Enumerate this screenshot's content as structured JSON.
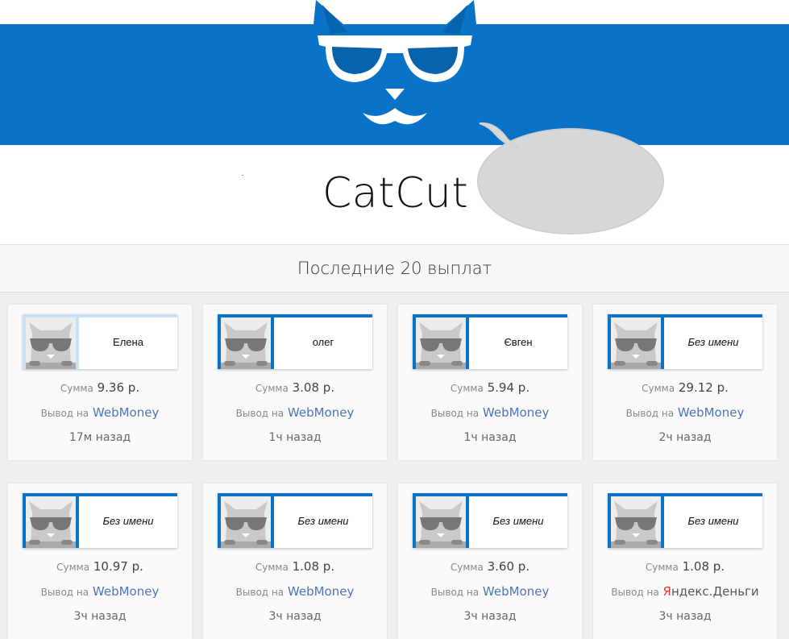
{
  "brand": {
    "title": "CatCut"
  },
  "section": {
    "title": "Последние 20 выплат"
  },
  "labels": {
    "sum_prefix": "Сумма",
    "withdraw_prefix": "Вывод на"
  },
  "payouts": [
    {
      "name": "Елена",
      "amount": "9.36 р.",
      "method": "WebMoney",
      "time": "17м назад",
      "italic": false,
      "faded": true
    },
    {
      "name": "олег",
      "amount": "3.08 р.",
      "method": "WebMoney",
      "time": "1ч назад",
      "italic": false,
      "faded": false
    },
    {
      "name": "Євген",
      "amount": "5.94 р.",
      "method": "WebMoney",
      "time": "1ч назад",
      "italic": false,
      "faded": false
    },
    {
      "name": "Без имени",
      "amount": "29.12 р.",
      "method": "WebMoney",
      "time": "2ч назад",
      "italic": true,
      "faded": false
    },
    {
      "name": "Без имени",
      "amount": "10.97 р.",
      "method": "WebMoney",
      "time": "3ч назад",
      "italic": true,
      "faded": false
    },
    {
      "name": "Без имени",
      "amount": "1.08 р.",
      "method": "WebMoney",
      "time": "3ч назад",
      "italic": true,
      "faded": false
    },
    {
      "name": "Без имени",
      "amount": "3.60 р.",
      "method": "WebMoney",
      "time": "3ч назад",
      "italic": true,
      "faded": false
    },
    {
      "name": "Без имени",
      "amount": "1.08 р.",
      "method_first": "Я",
      "method_rest": "ндекс.Деньги",
      "time": "3ч назад",
      "italic": true,
      "faded": false
    }
  ],
  "colors": {
    "brand_blue": "#0a73c8",
    "link": "#4d74b6"
  },
  "icons": {
    "mascot": "cat-with-sunglasses-logo",
    "avatar": "cat-avatar-icon",
    "bubble": "speech-bubble"
  }
}
